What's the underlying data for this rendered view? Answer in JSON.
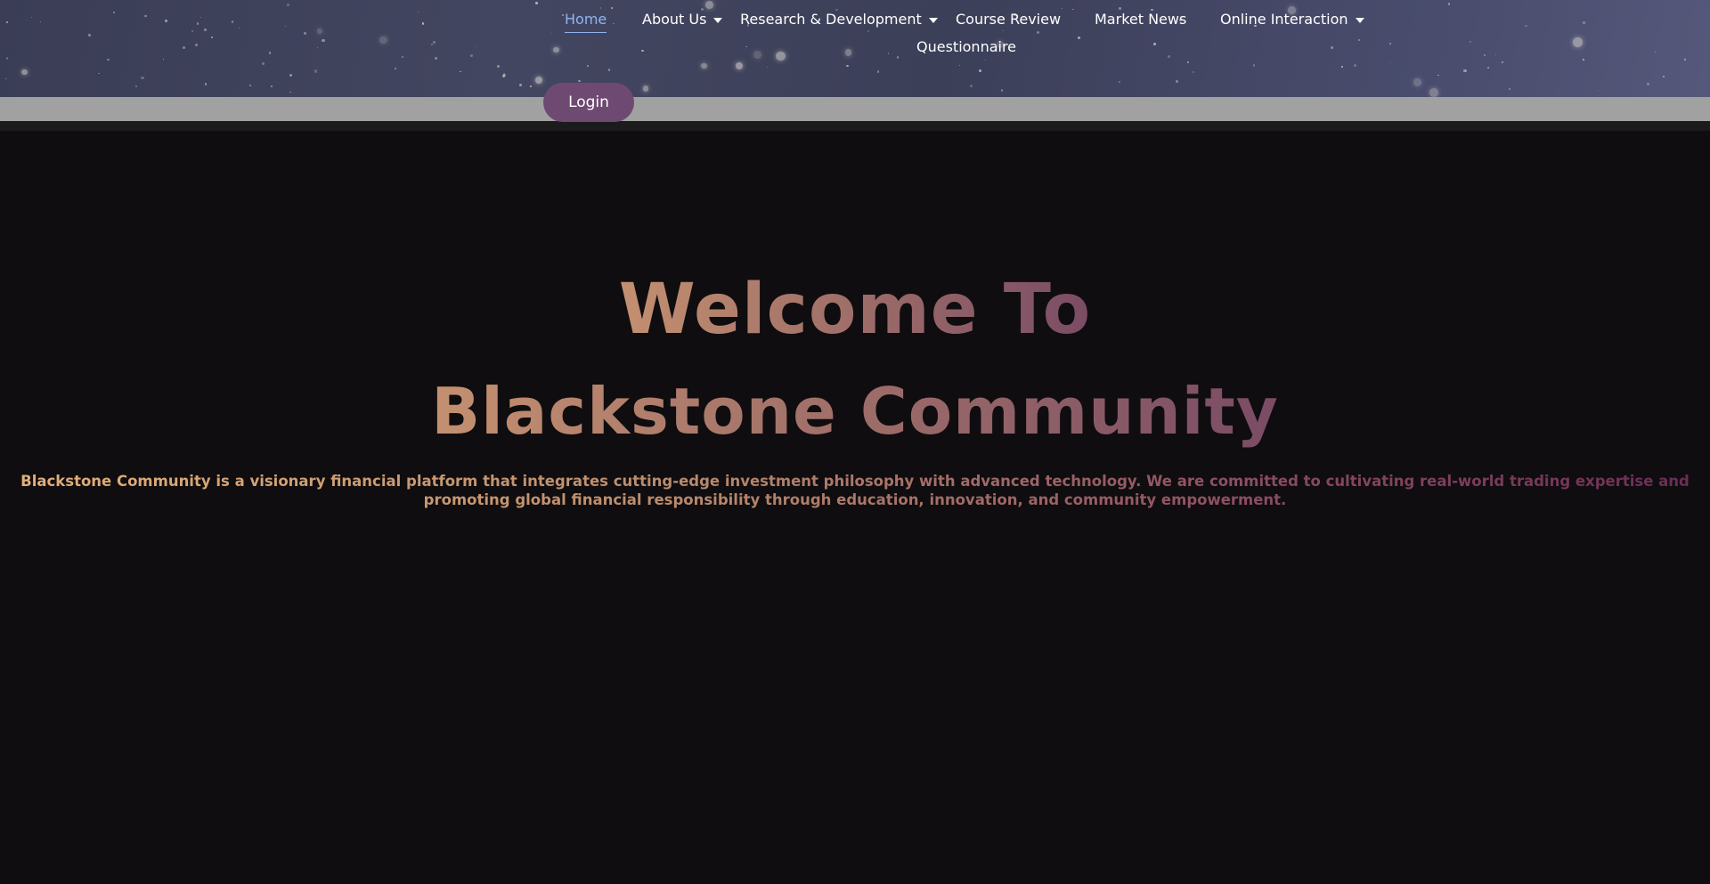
{
  "nav": {
    "home": "Home",
    "about": "About Us",
    "research": "Research & Development",
    "course": "Course Review",
    "market": "Market News",
    "online": "Online Interaction",
    "questionnaire": "Questionnaire"
  },
  "login_label": "Login",
  "hero": {
    "title_line1": "Welcome To",
    "title_line2": "Blackstone Community",
    "description": "Blackstone Community is a visionary financial platform that integrates cutting-edge investment philosophy with advanced technology. We are committed to cultivating real-world trading expertise and promoting global financial responsibility through education, innovation, and community empowerment."
  },
  "colors": {
    "nav_active": "#8fb4f2",
    "login_bg": "#6e4a72",
    "background": "#0f0d0f",
    "title_gradient_start": "#c49070",
    "title_gradient_end": "#7a4c65"
  },
  "icons": [
    "chevron-down-icon"
  ]
}
